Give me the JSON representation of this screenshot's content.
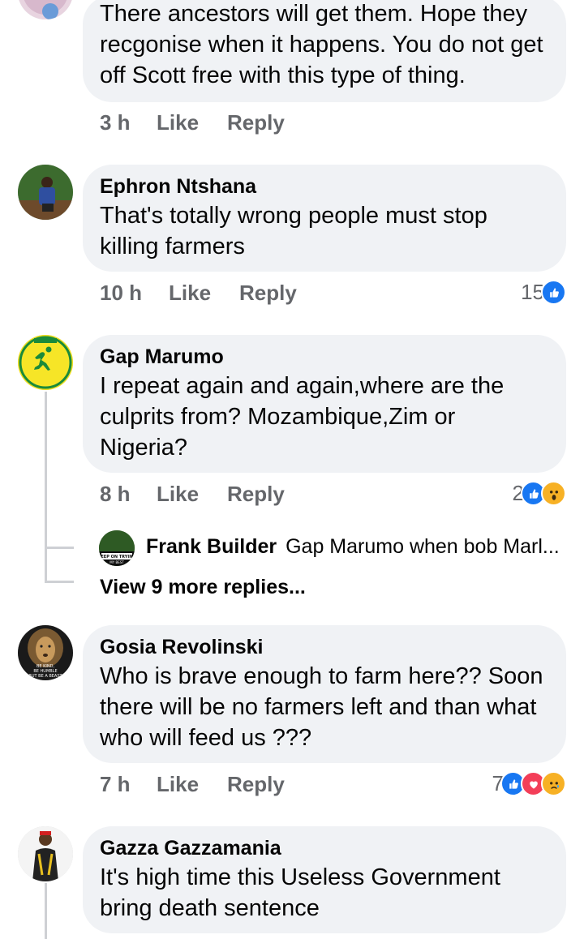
{
  "comments": [
    {
      "text": "There ancestors will get them. Hope they recgonise  when it happens. You do not get off Scott free with this type of thing.",
      "time": "3 h",
      "like": "Like",
      "reply": "Reply"
    },
    {
      "author": "Ephron Ntshana",
      "text": "That's totally wrong people must stop killing farmers",
      "time": "10 h",
      "like": "Like",
      "reply": "Reply",
      "reaction_count": "15",
      "reactions": [
        "like-icon"
      ]
    },
    {
      "author": "Gap Marumo",
      "text": "I repeat again and again,where are the culprits from? Mozambique,Zim or Nigeria?",
      "time": "8 h",
      "like": "Like",
      "reply": "Reply",
      "reaction_count": "2",
      "reactions": [
        "like-icon",
        "wow-icon"
      ],
      "reply_preview": {
        "author": "Frank Builder",
        "text": "Gap Marumo when bob Marl...",
        "avatar_text": "KEEP ON TRYING MY BEST"
      },
      "view_more": "View 9 more replies..."
    },
    {
      "author": "Gosia Revolinski",
      "text": "Who is brave enough to farm here?? Soon there will be no farmers  left and than what who will feed us ???",
      "time": "7 h",
      "like": "Like",
      "reply": "Reply",
      "reaction_count": "7",
      "reactions": [
        "like-icon",
        "love-icon",
        "sad-icon"
      ],
      "avatar_text": "BE KIND, BE HUMBLE BUT BE A BEAST"
    },
    {
      "author": "Gazza Gazzamania",
      "text": "It's high time this Useless Government bring death sentence"
    }
  ],
  "colors": {
    "bubble": "#f0f2f5",
    "meta": "#65676b",
    "like_blue": "#1877f2",
    "love_red": "#f33e58",
    "wow_yellow": "#f7b125"
  }
}
